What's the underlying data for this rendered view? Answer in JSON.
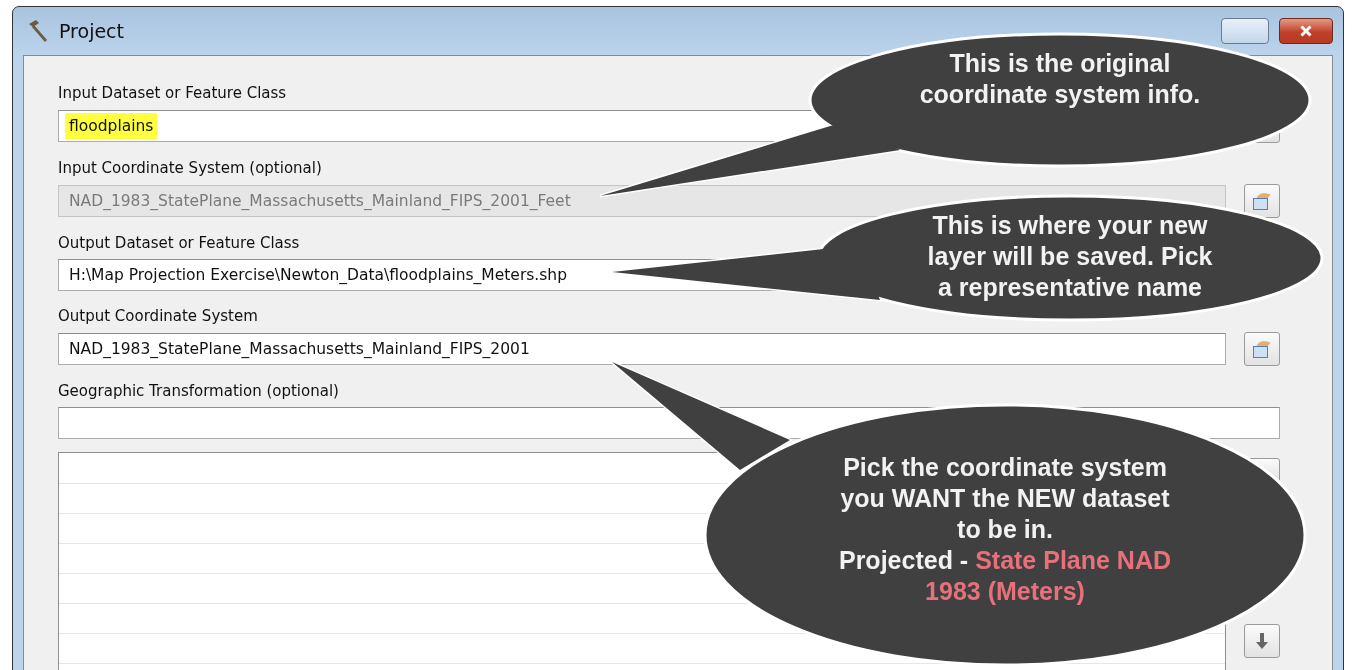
{
  "window": {
    "title": "Project"
  },
  "fields": [
    {
      "label": "Input Dataset or Feature Class",
      "value": "floodplains",
      "highlighted": true,
      "disabled": false,
      "kind": "browse"
    },
    {
      "label": "Input Coordinate System (optional)",
      "value": "NAD_1983_StatePlane_Massachusetts_Mainland_FIPS_2001_Feet",
      "highlighted": false,
      "disabled": true,
      "kind": "picker"
    },
    {
      "label": "Output Dataset or Feature Class",
      "value": "H:\\Map Projection Exercise\\Newton_Data\\floodplains_Meters.shp",
      "highlighted": false,
      "disabled": false,
      "kind": "plain"
    },
    {
      "label": "Output Coordinate System",
      "value": "NAD_1983_StatePlane_Massachusetts_Mainland_FIPS_2001",
      "highlighted": false,
      "disabled": false,
      "kind": "picker"
    },
    {
      "label": "Geographic Transformation (optional)",
      "highlighted": false,
      "disabled": false,
      "kind": "wide"
    }
  ],
  "callouts": [
    {
      "lines": [
        [
          {
            "text": "This is the original",
            "emphasis": false
          }
        ],
        [
          {
            "text": "coordinate system info.",
            "emphasis": false
          }
        ]
      ]
    },
    {
      "lines": [
        [
          {
            "text": "This is where your new",
            "emphasis": false
          }
        ],
        [
          {
            "text": "layer will be saved. Pick",
            "emphasis": false
          }
        ],
        [
          {
            "text": "a representative name",
            "emphasis": false
          }
        ]
      ]
    },
    {
      "lines": [
        [
          {
            "text": "Pick the coordinate system",
            "emphasis": false
          }
        ],
        [
          {
            "text": "you WANT the NEW dataset",
            "emphasis": false
          }
        ],
        [
          {
            "text": "to be in.",
            "emphasis": false
          }
        ],
        [
          {
            "text": "Projected - ",
            "emphasis": false
          },
          {
            "text": "State Plane NAD",
            "emphasis": true
          }
        ],
        [
          {
            "text": "1983 (Meters)",
            "emphasis": true
          }
        ]
      ]
    }
  ]
}
